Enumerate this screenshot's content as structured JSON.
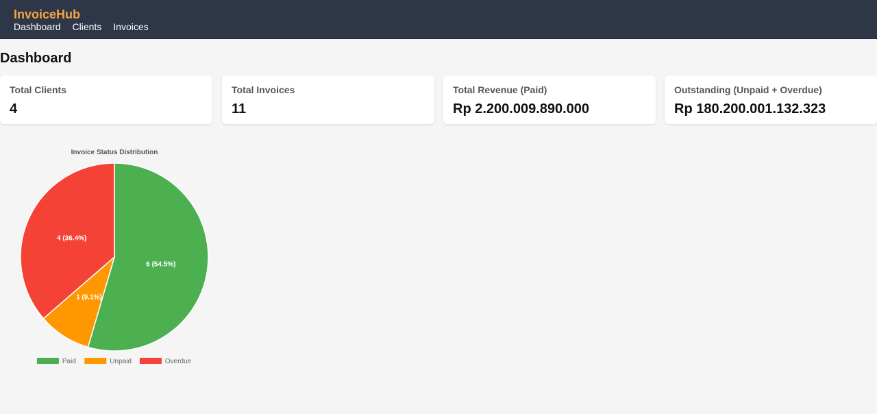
{
  "app": {
    "brand": "InvoiceHub",
    "nav": [
      "Dashboard",
      "Clients",
      "Invoices"
    ]
  },
  "page": {
    "title": "Dashboard"
  },
  "stats": [
    {
      "label": "Total Clients",
      "value": "4"
    },
    {
      "label": "Total Invoices",
      "value": "11"
    },
    {
      "label": "Total Revenue (Paid)",
      "value": "Rp 2.200.009.890.000"
    },
    {
      "label": "Outstanding (Unpaid + Overdue)",
      "value": "Rp 180.200.001.132.323"
    }
  ],
  "chart_data": {
    "type": "pie",
    "title": "Invoice Status Distribution",
    "categories": [
      "Paid",
      "Unpaid",
      "Overdue"
    ],
    "values": [
      6,
      1,
      4
    ],
    "labels": [
      "6 (54.5%)",
      "1 (9.1%)",
      "4 (36.4%)"
    ],
    "colors": [
      "#4caf50",
      "#ff9800",
      "#f44336"
    ],
    "legend": "bottom"
  }
}
